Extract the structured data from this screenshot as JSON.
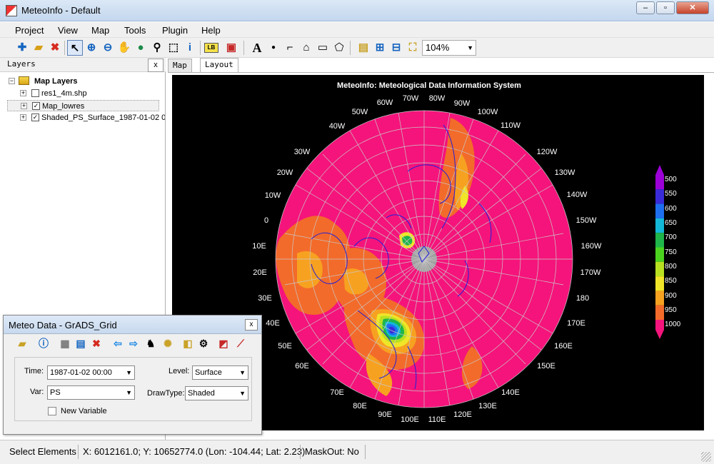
{
  "window": {
    "title": "MeteoInfo - Default"
  },
  "menu": [
    "Project",
    "View",
    "Map",
    "Tools",
    "Plugin",
    "Help"
  ],
  "toolbar": {
    "zoom": "104%"
  },
  "layers_panel": {
    "title": "Layers",
    "close": "x",
    "root": "Map Layers",
    "items": [
      {
        "label": "res1_4m.shp",
        "checked": false
      },
      {
        "label": "Map_lowres",
        "checked": true
      },
      {
        "label": "Shaded_PS_Surface_1987-01-02 0",
        "checked": true
      }
    ]
  },
  "tabs": [
    {
      "label": "Map"
    },
    {
      "label": "Layout"
    }
  ],
  "map": {
    "title": "MeteoInfo: Meteological Data Information System",
    "lon_labels": [
      "0",
      "10W",
      "20W",
      "30W",
      "40W",
      "50W",
      "60W",
      "70W",
      "80W",
      "90W",
      "100W",
      "110W",
      "120W",
      "130W",
      "140W",
      "150W",
      "160W",
      "170W",
      "180",
      "170E",
      "160E",
      "150E",
      "140E",
      "130E",
      "120E",
      "110E",
      "100E",
      "90E",
      "80E",
      "70E",
      "60E",
      "50E",
      "40E",
      "30E",
      "20E",
      "10E"
    ],
    "legend": [
      "500",
      "550",
      "600",
      "650",
      "700",
      "750",
      "800",
      "850",
      "900",
      "950",
      "1000"
    ],
    "legend_colors": [
      "#9b00d6",
      "#3a2bd8",
      "#1e6ef0",
      "#13b8d8",
      "#1fb54a",
      "#4bd21f",
      "#b8e021",
      "#f0e528",
      "#f7a121",
      "#f36b2a",
      "#f5147b"
    ]
  },
  "dialog": {
    "title": "Meteo Data - GrADS_Grid",
    "close": "x",
    "time_label": "Time:",
    "time_value": "1987-01-02 00:00",
    "level_label": "Level:",
    "level_value": "Surface",
    "var_label": "Var:",
    "var_value": "PS",
    "drawtype_label": "DrawType:",
    "drawtype_value": "Shaded",
    "new_variable": "New Variable"
  },
  "status": {
    "mode": "Select Elements",
    "coords": "X: 6012161.0; Y: 10652774.0 (Lon: -104.44; Lat: 2.23)",
    "mask": "MaskOut: No"
  }
}
